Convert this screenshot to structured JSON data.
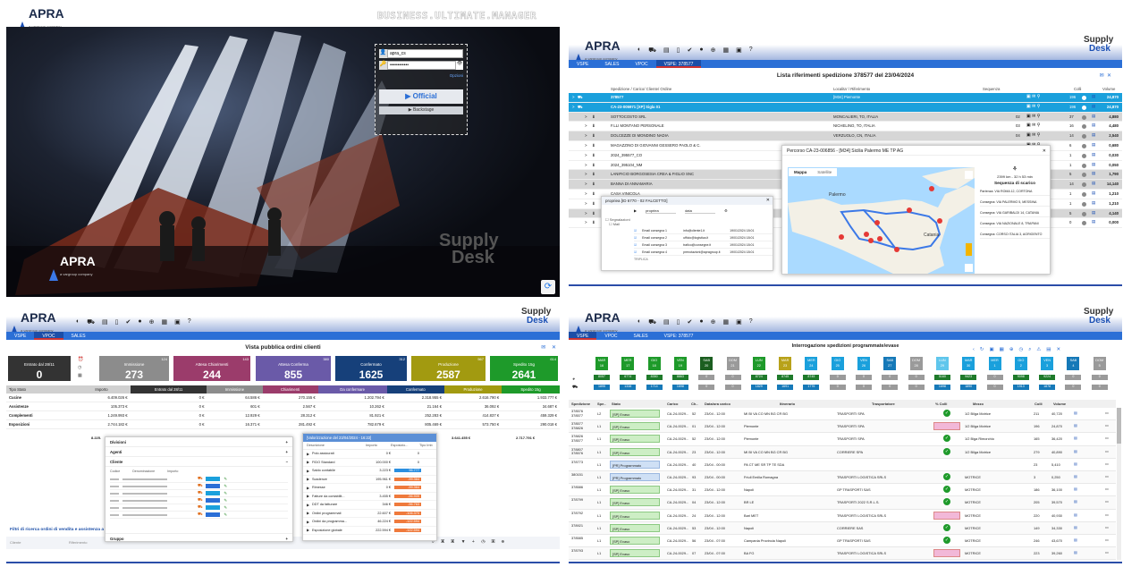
{
  "login": {
    "brand": "APRA",
    "brand_sub": "a vargroup company",
    "app_title": "BUSINESS.ULTIMATE.MANAGER",
    "username": "apra_cs",
    "password_mask": "••••••••••••",
    "link": "Opzioni",
    "primary_button": "Official",
    "secondary_button": "Backstage",
    "supply": "Supply",
    "desk": "Desk"
  },
  "shipment": {
    "brand": "APRA",
    "brand_sub": "a vargroup company",
    "supply": "Supply",
    "desk": "Desk",
    "tabs": [
      "VSPE",
      "SALES",
      "VPOC",
      "VSPE: 378577"
    ],
    "title": "Lista riferimenti spedizione 378577 del 23/04/2024",
    "headers": {
      "spedizione": "Spedizione / Carico/ Cliente/ Ordine",
      "localita": "Localita' / Riferimento",
      "sequenza": "Sequenza",
      "colli": "Colli",
      "volume": "Volume"
    },
    "rows": [
      {
        "id": "378577",
        "loc": "[M34] Piemonte",
        "colli": "196",
        "vol": "24,870",
        "style": "blue"
      },
      {
        "id": "CA-23-005971 [XP] Sigla 01",
        "loc": "",
        "colli": "196",
        "vol": "24,870",
        "style": "blue"
      },
      {
        "id": "SOTTOCOSTO SRL",
        "loc": "MONCALIERI, TO, ITALIA",
        "seq": "02",
        "colli": "37",
        "vol": "4,880",
        "style": "gray"
      },
      {
        "id": "F.LLI MONTANO PERSONALE",
        "loc": "NICHELINO, TO, ITALIA",
        "seq": "03",
        "colli": "16",
        "vol": "4,480",
        "style": "white"
      },
      {
        "id": "DOLCEZZE DI MONDINO NADIA",
        "loc": "VERZUOLO, CN, ITALIA",
        "seq": "04",
        "colli": "14",
        "vol": "2,540",
        "style": "gray"
      },
      {
        "id": "MAGAZZINO DI GIOVANNI GESSERO PAOLO & C.",
        "loc": "",
        "colli": "6",
        "vol": "0,680",
        "style": "white"
      },
      {
        "id": "2024_395577_CO",
        "loc": "",
        "colli": "1",
        "vol": "0,030",
        "style": "white"
      },
      {
        "id": "2024_395104_NM",
        "loc": "",
        "colli": "1",
        "vol": "0,050",
        "style": "white"
      },
      {
        "id": "LANIFICIO BORGOSESIA CREA & FIGLIO SNC",
        "loc": "",
        "colli": "5",
        "vol": "1,790",
        "style": "gray"
      },
      {
        "id": "BANNA DI ANNAMARIA",
        "loc": "",
        "colli": "14",
        "vol": "14,140",
        "style": "gray"
      },
      {
        "id": "CASA VINICOLA",
        "loc": "",
        "colli": "1",
        "vol": "1,210",
        "style": "white"
      },
      {
        "id": "",
        "loc": "",
        "colli": "1",
        "vol": "1,210",
        "style": "white"
      },
      {
        "id": "",
        "loc": "",
        "colli": "5",
        "vol": "4,140",
        "style": "gray"
      },
      {
        "id": "",
        "loc": "",
        "colli": "0",
        "vol": "0,000",
        "style": "white"
      }
    ],
    "popup_mail": {
      "title": "propriea [ID 6770 - 02 FALCETTO]",
      "field1": "propriea",
      "field2": "data",
      "folder1": "Segnalazioni",
      "folder2": "Mail",
      "rows": [
        {
          "from": "Email consegna 1",
          "to": "info@cliente1.it",
          "date": "19/01/2024 18:01"
        },
        {
          "from": "Email consegna 2",
          "to": "ufficio@logistica.it",
          "date": "19/01/2024 18:01"
        },
        {
          "from": "Email consegna 3",
          "to": "trafico@consegne.it",
          "date": "19/01/2024 18:01"
        },
        {
          "from": "Email consegna 4",
          "to": "prenotazioni@apragroup.it",
          "date": "19/01/2024 18:01"
        }
      ],
      "footer": "TRIPLICA"
    },
    "popup_map": {
      "title": "Percorso CA-23-006856 - [M34] Sicilia Palermo ME TP AG",
      "tab_map": "Mappa",
      "tab_sat": "Satellite",
      "city1": "Palermo",
      "city2": "Catania",
      "summary": "2399 km - 32 h 53 min",
      "seq_title": "Sequenza di scarico",
      "stops": [
        "Partenza: VIA ROMA 12, CORTONA",
        "Consegna: VIA PALERMO 5, MESSINA",
        "Consegna: VIA GARIBALDI 14, CATANIA",
        "Consegna: VIA NAZIONALE 8, TRAPANI",
        "Consegna: CORSO ITALIA 3, AGRIGENTO"
      ]
    }
  },
  "orders": {
    "brand": "APRA",
    "brand_sub": "a vargroup company",
    "supply": "Supply",
    "desk": "Desk",
    "tabs": [
      "VSPE",
      "VPOC",
      "SALES"
    ],
    "title": "Vista pubblica ordini clienti",
    "kpis": [
      {
        "label": "Entrato dal 28/11",
        "value": "0",
        "count": "",
        "color": "#333333"
      },
      {
        "label": "Immissione",
        "value": "273",
        "count": "124",
        "color": "#8c8c8c"
      },
      {
        "label": "Attesa Chiarimenti",
        "value": "244",
        "count": "143",
        "color": "#9b3c6b"
      },
      {
        "label": "Attesa Conferma",
        "value": "855",
        "count": "380",
        "color": "#6a5aa8"
      },
      {
        "label": "Confermato",
        "value": "1625",
        "count": "312",
        "color": "#16407a"
      },
      {
        "label": "Produzione",
        "value": "2587",
        "count": "567",
        "color": "#a29a10"
      },
      {
        "label": "Spedito 15g",
        "value": "2641",
        "count": "614",
        "color": "#1e9a2a"
      }
    ],
    "table_head": [
      "Tipo Stato",
      "Importo",
      "Entrato dal 28/11",
      "Immissione",
      "Chiarimenti",
      "Da confermare",
      "Confermato",
      "Produzione",
      "Spedito 15g"
    ],
    "table_rows": [
      [
        "Cucine",
        "6.409.026 €",
        "0 €",
        "64.586 €",
        "270.155 €",
        "1.202.794 €",
        "2.318.955 €",
        "2.616.790 €",
        "1.933.777 €"
      ],
      [
        "Assistenze",
        "105.373 €",
        "0 €",
        "601 €",
        "2.567 €",
        "10.262 €",
        "21.164 €",
        "36.092 €",
        "34.687 €"
      ],
      [
        "Complementi",
        "1.249.993 €",
        "0 €",
        "12.929 €",
        "28.312 €",
        "81.921 €",
        "252.283 €",
        "414.837 €",
        "459.329 €"
      ],
      [
        "Esposizioni",
        "2.744.182 €",
        "0 €",
        "16.371 €",
        "281.492 €",
        "782.679 €",
        "805.469 €",
        "573.750 €",
        "290.018 €"
      ]
    ],
    "tot": "8.225.",
    "tot2": "3.641.455 €",
    "tot3": "2.717.791 €",
    "filter_title": "Filtri di ricerca ordini di vendita e assistenza a",
    "filter_fields": [
      "Cliente",
      "Riferimento"
    ],
    "popup_left": {
      "groups": [
        "Divisioni",
        "Agenti",
        "Cliente",
        "Gruppo"
      ],
      "cols": [
        "Codice",
        "Denominazione",
        "Importo"
      ]
    },
    "popup_right": {
      "title": "[Valorizzazione del 23/04/2024 - 16:22]",
      "cols": [
        "Descrizione",
        "Importo",
        "Esposizio...",
        "Tipo Imb"
      ],
      "rows": [
        [
          "Polo assicurati",
          "0 €",
          "0"
        ],
        [
          "FIDO Standard",
          "100.000 €",
          "0"
        ],
        [
          "Saldo contabile",
          "3.223 €",
          "96.777"
        ],
        [
          "Scadenze",
          "195.961 €",
          "-99.364"
        ],
        [
          "Rimesse",
          "0 €",
          "-99.364"
        ],
        [
          "Fatture da contabilit...",
          "3.455 €",
          "-96.909"
        ],
        [
          "DDT da fatturare",
          "346 €",
          "-96.763"
        ],
        [
          "Ordini programmati",
          "22.607 €",
          "-106.370"
        ],
        [
          "Ordini da programma...",
          "46.224 €",
          "-122.594"
        ],
        [
          "Esposizione globale",
          "222.594 €",
          "-122.594"
        ]
      ]
    }
  },
  "scheduled": {
    "brand": "APRA",
    "brand_sub": "a vargroup company",
    "supply": "Supply",
    "desk": "Desk",
    "tabs": [
      "VSPE",
      "VPOC",
      "SALES",
      "VSPE: 378577"
    ],
    "title": "Interrogazione spedizioni programmate/evase",
    "days": [
      {
        "d": "MAR",
        "n": "16",
        "c": "#1e9a2a",
        "a": "8057",
        "b": "1895"
      },
      {
        "d": "MER",
        "n": "17",
        "c": "#1e9a2a",
        "a": "6774",
        "b": "1338"
      },
      {
        "d": "GIO",
        "n": "18",
        "c": "#1e9a2a",
        "a": "8350",
        "b": "1714"
      },
      {
        "d": "VEN",
        "n": "19",
        "c": "#1e9a2a",
        "a": "8863",
        "b": "1698"
      },
      {
        "d": "SAB",
        "n": "20",
        "c": "#1b5e20",
        "a": "0",
        "b": "0"
      },
      {
        "d": "DOM",
        "n": "21",
        "c": "#9a9a9a",
        "a": "0",
        "b": "0"
      },
      {
        "d": "LUN",
        "n": "22",
        "c": "#1e9a2a",
        "a": "8724",
        "b": "1829"
      },
      {
        "d": "MAR",
        "n": "23",
        "c": "#b8a21a",
        "a": "8745",
        "b": "1691"
      },
      {
        "d": "MER",
        "n": "24",
        "c": "#1aa0dc",
        "a": "8745",
        "b": "1776"
      },
      {
        "d": "GIO",
        "n": "25",
        "c": "#1aa0dc",
        "a": "0",
        "b": "0"
      },
      {
        "d": "VEN",
        "n": "26",
        "c": "#1aa0dc",
        "a": "0",
        "b": "0"
      },
      {
        "d": "SAB",
        "n": "27",
        "c": "#1679b8",
        "a": "0",
        "b": "0"
      },
      {
        "d": "DOM",
        "n": "28",
        "c": "#9a9a9a",
        "a": "0",
        "b": "0"
      },
      {
        "d": "LUN",
        "n": "29",
        "c": "#5fc6ec",
        "a": "5160",
        "b": "1698"
      },
      {
        "d": "MAR",
        "n": "30",
        "c": "#1aa0dc",
        "a": "9423",
        "b": "1890"
      },
      {
        "d": "MER",
        "n": "1",
        "c": "#1aa0dc",
        "a": "0",
        "b": "0"
      },
      {
        "d": "GIO",
        "n": "2",
        "c": "#1aa0dc",
        "a": "9098",
        "b": "1913"
      },
      {
        "d": "VEN",
        "n": "3",
        "c": "#1aa0dc",
        "a": "9224",
        "b": "1878"
      },
      {
        "d": "SAB",
        "n": "4",
        "c": "#1679b8",
        "a": "0",
        "b": "0"
      },
      {
        "d": "DOM",
        "n": "5",
        "c": "#9a9a9a",
        "a": "0",
        "b": "0"
      }
    ],
    "head": [
      "Spedizione",
      "Spe..",
      "Stato",
      "Carico",
      "Ch..",
      "Data/ora carico",
      "Itinerario",
      "Trasportatore",
      "% Colli",
      "Mezzo",
      "Colli",
      "Volume"
    ],
    "rows": [
      {
        "sp": "378576\n378577",
        "l": "L2",
        "st": "[SP] Evaso",
        "ca": "CA-24-0029...",
        "ch": "52",
        "dt": "23/04 - 12:00",
        "it": "MI BI VA CO MN BG CR BG",
        "tr": "TRASPORTI SPA",
        "ok": "1",
        "mz": "1/2 Bilga Motrice",
        "co": "211",
        "vo": "40,720"
      },
      {
        "sp": "378577\n378826",
        "l": "L1",
        "st": "[SP] Evaso",
        "ca": "CA-24-0029...",
        "ch": "01",
        "dt": "23/04 - 12:00",
        "it": "Piemonte",
        "tr": "TRASPORTI SPA",
        "ok": "0",
        "mz": "1/2 Bilga Motrice",
        "co": "196",
        "vo": "24,870"
      },
      {
        "sp": "378826\n378577",
        "l": "L1",
        "st": "[SP] Evaso",
        "ca": "CA-24-0029...",
        "ch": "52",
        "dt": "23/04 - 12:00",
        "it": "Piemonte",
        "tr": "TRASPORTI SPA",
        "ok": "1",
        "mz": "1/2 Biga Rimorchio",
        "co": "165",
        "vo": "36,420"
      },
      {
        "sp": "378807\n378576",
        "l": "L1",
        "st": "[SP] Evaso",
        "ca": "CA-24-0029...",
        "ch": "23",
        "dt": "23/04 - 12:00",
        "it": "MI BI VA CO MN BG CR BG",
        "tr": "CORRIERE SPA",
        "ok": "1",
        "mz": "1/2 Bilga Motrice",
        "co": "279",
        "vo": "40,890"
      },
      {
        "sp": "378773",
        "l": "L1",
        "st": "[PR] Programmato",
        "ca": "CA-24-0029...",
        "ch": "40",
        "dt": "23/04 - 00:00",
        "it": "PA CT ME SR TP TE SDA",
        "tr": "",
        "ok": "",
        "mz": "",
        "co": "23",
        "vo": "5,410"
      },
      {
        "sp": "380151",
        "l": "L1",
        "st": "[PR] Programmato",
        "ca": "CA-24-0029...",
        "ch": "93",
        "dt": "23/04 - 00:00",
        "it": "Friuli Emilia Romagna",
        "tr": "TRASPORTI LOGISTICA SRLS",
        "ok": "1",
        "mz": "MOTRICE",
        "co": "3",
        "vo": "0,250"
      },
      {
        "sp": "378586",
        "l": "L1",
        "st": "[SP] Evaso",
        "ca": "CA-24-0029...",
        "ch": "31",
        "dt": "23/04 - 12:00",
        "it": "Napoli",
        "tr": "GP TRASPORTI SAS",
        "ok": "1",
        "mz": "MOTRICE",
        "co": "186",
        "vo": "36,100"
      },
      {
        "sp": "378799",
        "l": "L1",
        "st": "[SP] Evaso",
        "ca": "CA-24-0029...",
        "ch": "04",
        "dt": "23/04 - 12:00",
        "it": "BR LE",
        "tr": "TRASPORTI 2022 S.R.L.S.",
        "ok": "1",
        "mz": "MOTRICE",
        "co": "205",
        "vo": "39,570"
      },
      {
        "sp": "378792",
        "l": "L1",
        "st": "[SP] Evaso",
        "ca": "CA-24-0029...",
        "ch": "24",
        "dt": "23/04 - 12:00",
        "it": "Bari MET",
        "tr": "TRASPORTI LOGISTICA SRLS",
        "ok": "0",
        "mz": "MOTRICE",
        "co": "220",
        "vo": "40,930"
      },
      {
        "sp": "378921",
        "l": "L1",
        "st": "[SP] Evaso",
        "ca": "CA-24-0029...",
        "ch": "53",
        "dt": "23/04 - 12:00",
        "it": "Napoli",
        "tr": "CORRIERE SAS",
        "ok": "1",
        "mz": "MOTRICE",
        "co": "149",
        "vo": "34,330"
      },
      {
        "sp": "378585",
        "l": "L1",
        "st": "[SP] Evaso",
        "ca": "CA-24-0029...",
        "ch": "56",
        "dt": "23/04 - 07:00",
        "it": "Campania Provincia Napoli",
        "tr": "GP TRASPORTI SAS",
        "ok": "1",
        "mz": "MOTRICE",
        "co": "246",
        "vo": "43,670"
      },
      {
        "sp": "378793",
        "l": "L1",
        "st": "[SP] Evaso",
        "ca": "CA-24-0029...",
        "ch": "07",
        "dt": "23/04 - 07:00",
        "it": "BA FG",
        "tr": "TRASPORTI LOGISTICA SRLS",
        "ok": "0",
        "mz": "MOTRICE",
        "co": "223",
        "vo": "39,260"
      }
    ]
  }
}
